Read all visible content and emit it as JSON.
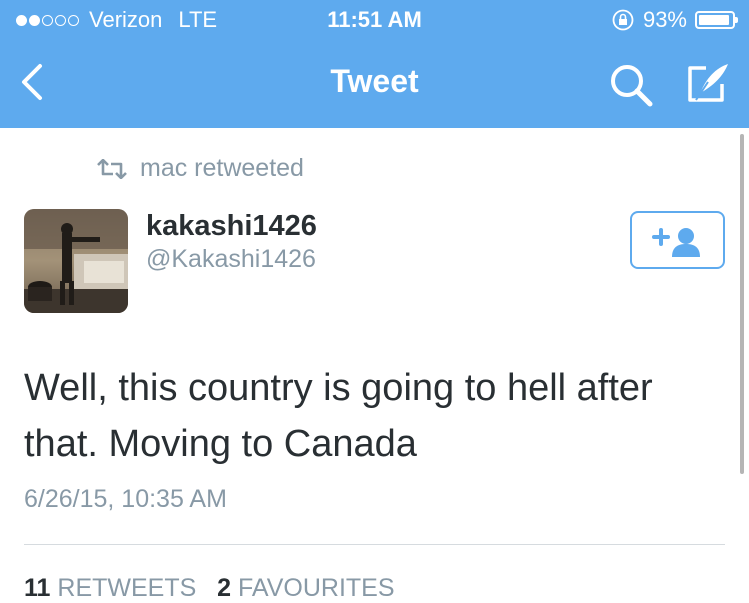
{
  "status_bar": {
    "carrier": "Verizon",
    "network": "LTE",
    "time": "11:51 AM",
    "battery_percent": "93%",
    "battery_level": 0.93,
    "signal_bars_filled": 2,
    "signal_bars_total": 5
  },
  "nav": {
    "title": "Tweet",
    "back_icon": "chevron-left-icon",
    "search_icon": "search-icon",
    "compose_icon": "compose-icon"
  },
  "tweet": {
    "retweeted_by": "mac retweeted",
    "author_name": "kakashi1426",
    "author_handle": "@Kakashi1426",
    "text": "Well, this country is going to hell after that. Moving to Canada",
    "timestamp": "6/26/15, 10:35 AM",
    "retweet_count": "11",
    "retweets_label": "RETWEETS",
    "favourite_count": "2",
    "favourites_label": "FAVOURITES"
  },
  "colors": {
    "accent": "#5eaaee",
    "text": "#292f33",
    "muted": "#8899a6"
  }
}
